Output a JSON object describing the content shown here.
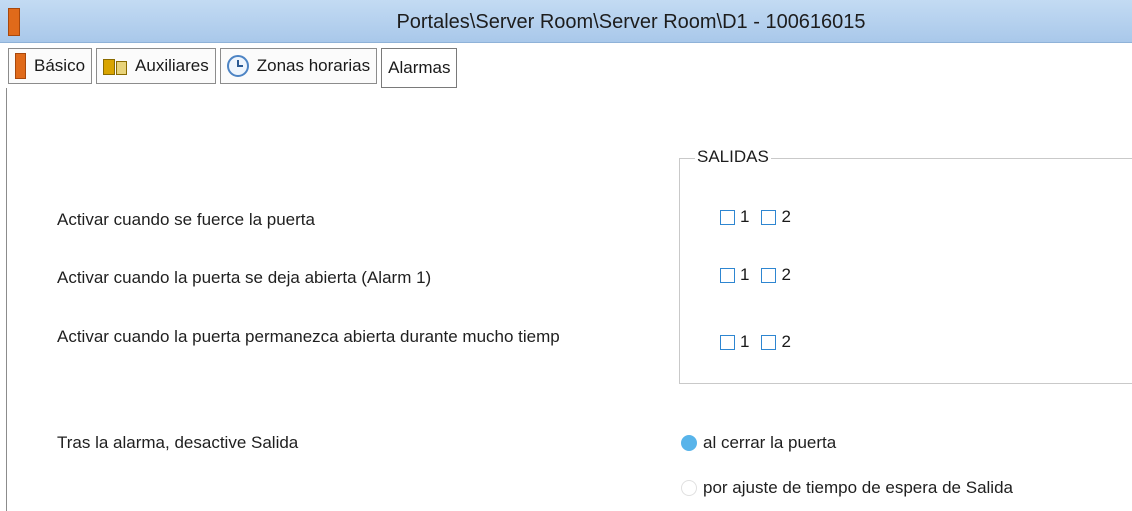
{
  "window": {
    "title": "Portales\\Server Room\\Server Room\\D1 - 100616015"
  },
  "tabs": [
    {
      "label": "Básico",
      "icon": "door-icon"
    },
    {
      "label": "Auxiliares",
      "icon": "auxiliary-icon"
    },
    {
      "label": "Zonas horarias",
      "icon": "clock-icon"
    },
    {
      "label": "Alarmas",
      "icon": ""
    }
  ],
  "active_tab": "Alarmas",
  "outputs": {
    "legend": "SALIDAS",
    "rows": [
      {
        "label": "Activar cuando se fuerce la puerta",
        "cb1": "1",
        "cb2": "2",
        "checked1": false,
        "checked2": false
      },
      {
        "label": "Activar cuando la puerta se deja abierta (Alarm 1)",
        "cb1": "1",
        "cb2": "2",
        "checked1": false,
        "checked2": false
      },
      {
        "label": "Activar cuando la puerta permanezca abierta durante mucho tiemp",
        "cb1": "1",
        "cb2": "2",
        "checked1": false,
        "checked2": false
      }
    ]
  },
  "after_alarm": {
    "label": "Tras la alarma, desactive Salida",
    "options": [
      {
        "label": "al cerrar la puerta",
        "selected": true
      },
      {
        "label": "por ajuste de tiempo de espera de Salida",
        "selected": false
      }
    ]
  },
  "colors": {
    "accent": "#58b4ea",
    "checkbox_border": "#2e86d1",
    "titlebar": "#b6d1ef"
  }
}
